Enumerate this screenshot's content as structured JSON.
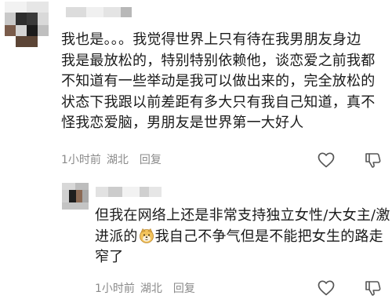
{
  "comment": {
    "text_lines": [
      "我也是。。。我觉得世界上只有待在我男朋友身边",
      "我是最放松的，特别特别依赖他，谈恋爱之前我都",
      "不知道有一些举动是我可以做出来的，完全放松的",
      "状态下我跟以前差距有多大只有我自己知道，真不",
      "怪我恋爱脑，男朋友是世界第一大好人"
    ],
    "time": "1小时前",
    "location": "湖北",
    "reply_label": "回复"
  },
  "reply": {
    "line1": "但我在网络上还是非常支持独立女性/大女主/激",
    "line2_before": "进派的",
    "emoji": "doge-emoji",
    "line2_after": "我自己不争气但是不能把女生的路走",
    "line3": "窄了",
    "time": "1小时前",
    "location": "湖北",
    "reply_label": "回复"
  },
  "icons": {
    "like": "heart-icon",
    "dislike": "thumbs-down-icon"
  }
}
